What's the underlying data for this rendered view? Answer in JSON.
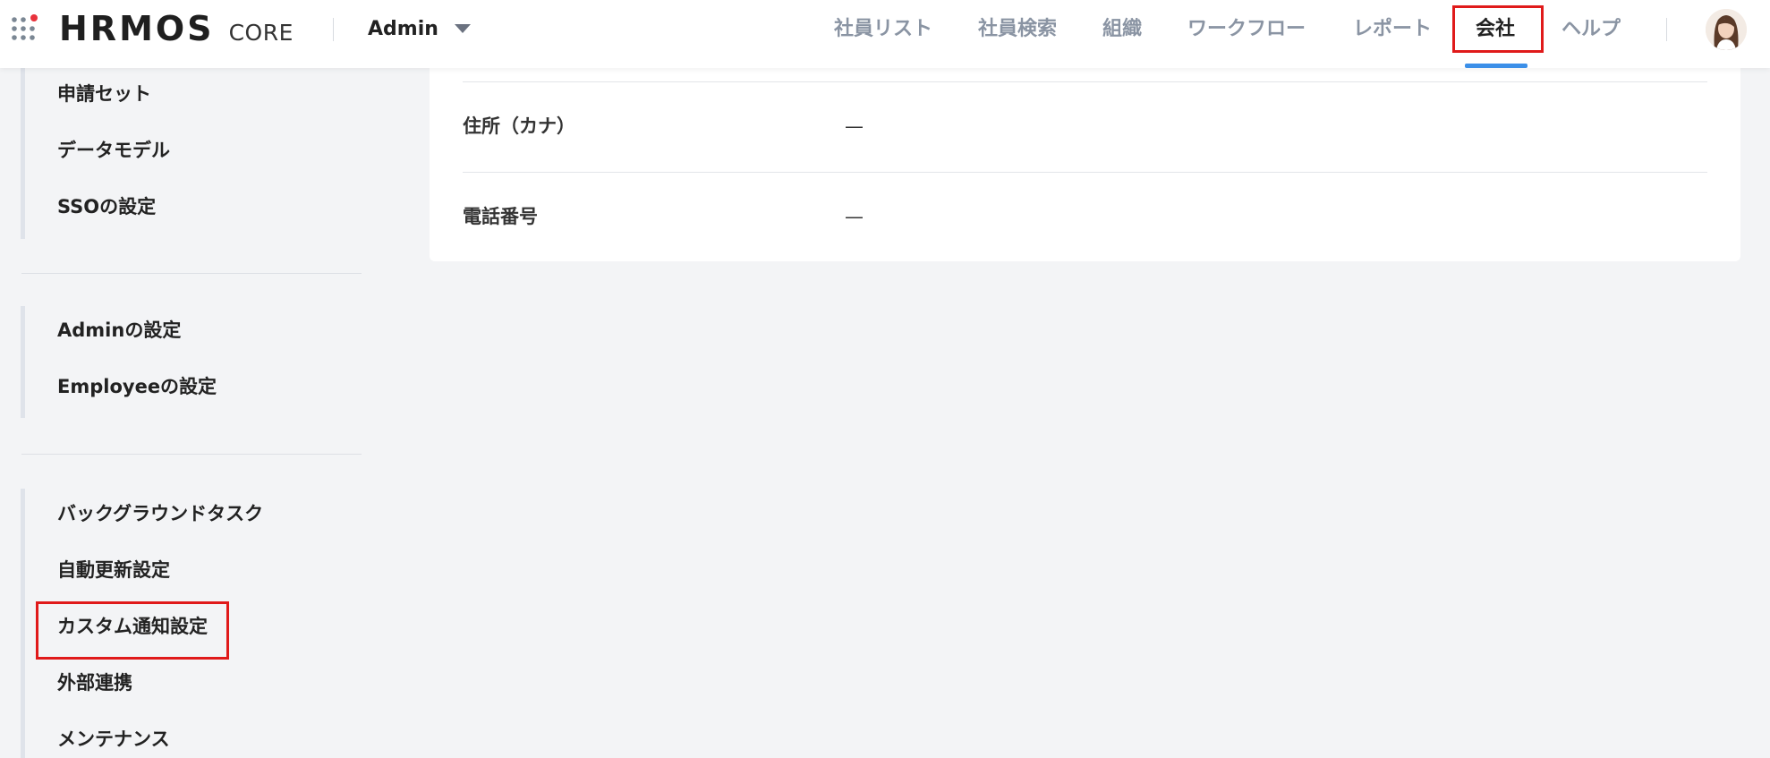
{
  "header": {
    "logo_main": "HRMOS",
    "logo_sub": "CORE",
    "app_switcher_label": "Admin",
    "nav": [
      {
        "label": "社員リスト"
      },
      {
        "label": "社員検索"
      },
      {
        "label": "組織"
      },
      {
        "label": "ワークフロー"
      },
      {
        "label": "レポート"
      },
      {
        "label": "会社",
        "active": true
      },
      {
        "label": "ヘルプ"
      }
    ]
  },
  "sidebar": {
    "group1": [
      "申請セット",
      "データモデル",
      "SSOの設定"
    ],
    "group2": [
      "Adminの設定",
      "Employeeの設定"
    ],
    "group3": [
      "バックグラウンドタスク",
      "自動更新設定",
      "カスタム通知設定",
      "外部連携",
      "メンテナンス"
    ]
  },
  "main": {
    "rows": [
      {
        "label": "住所（カナ）",
        "value": "—"
      },
      {
        "label": "電話番号",
        "value": "—"
      }
    ]
  },
  "colors": {
    "accent": "#3b8fe8",
    "highlight_box": "#e01a1a",
    "logo_dot": "#e8323c"
  },
  "icons": {
    "apps": "grid-dots-icon",
    "dropdown": "caret-down-icon",
    "avatar": "user-avatar"
  }
}
